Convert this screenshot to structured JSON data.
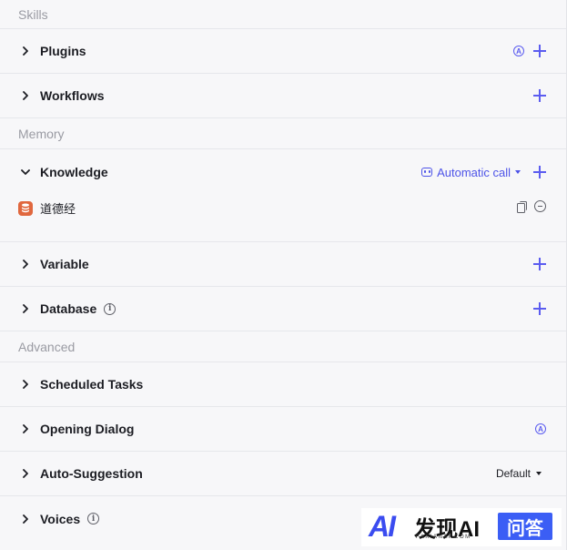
{
  "sections": {
    "skills": "Skills",
    "memory": "Memory",
    "advanced": "Advanced"
  },
  "rows": {
    "plugins": "Plugins",
    "workflows": "Workflows",
    "knowledge": "Knowledge",
    "variable": "Variable",
    "database": "Database",
    "scheduled_tasks": "Scheduled Tasks",
    "opening_dialog": "Opening Dialog",
    "auto_suggestion": "Auto-Suggestion",
    "voices": "Voices"
  },
  "knowledge": {
    "call_mode": "Automatic call",
    "items": [
      {
        "name": "道德经"
      }
    ]
  },
  "auto_suggestion": {
    "selected": "Default"
  },
  "badge_letter": "A",
  "info_letter": "i",
  "watermark": {
    "logo": "AI",
    "brand": "发现AI",
    "site": "FAXIANAI.COM",
    "box": "问答"
  },
  "colors": {
    "accent": "#5b5cf0",
    "link": "#4d53e8",
    "db_icon": "#e0673e",
    "background": "#f7f7f9"
  }
}
